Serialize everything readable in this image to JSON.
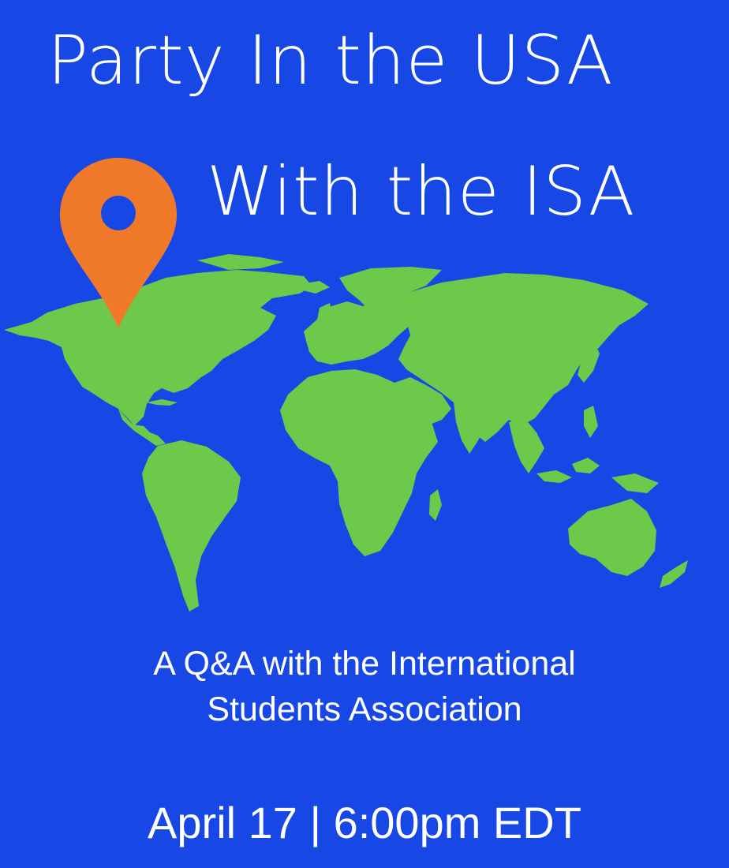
{
  "poster": {
    "title_line_1": "Party In the USA",
    "title_line_2": "With the ISA",
    "subtitle_line_1": "A Q&A with the International",
    "subtitle_line_2": "Students Association",
    "date_time": "April 17 | 6:00pm EDT"
  },
  "colors": {
    "background": "#1748e6",
    "land": "#6cc94a",
    "pin": "#f07a2a",
    "text": "#ffffff"
  },
  "icons": {
    "location_pin": "location-pin-icon",
    "world_map": "world-map"
  }
}
